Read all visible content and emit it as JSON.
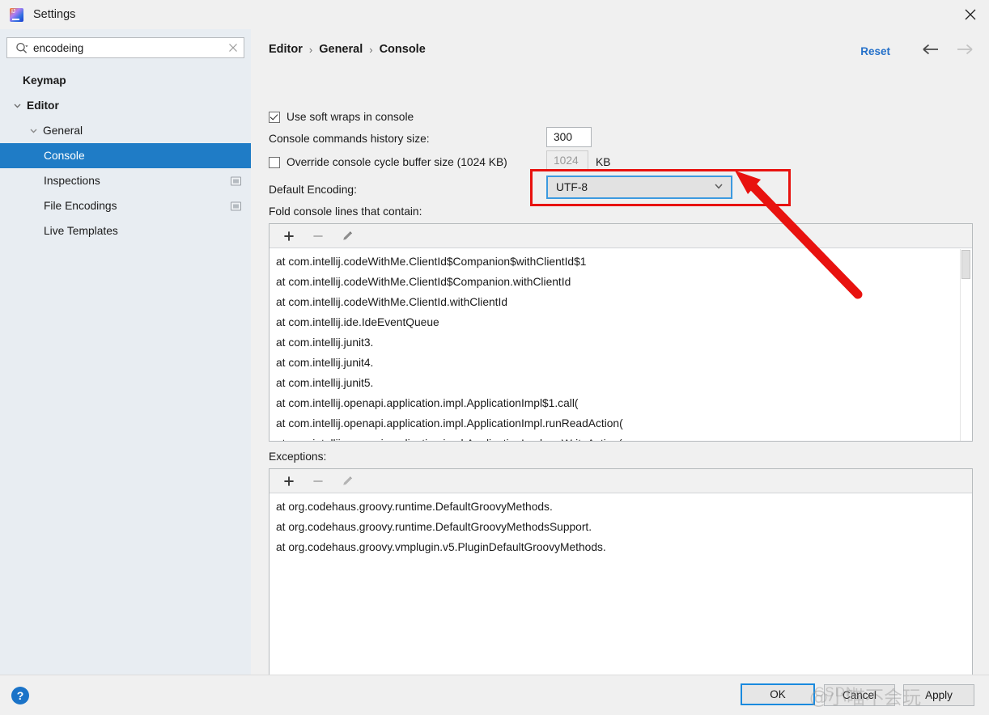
{
  "window": {
    "title": "Settings",
    "logo_icon": "intellij-idea-logo",
    "close_icon": "close-icon"
  },
  "search": {
    "value": "encodeing",
    "placeholder": "",
    "icon": "search-icon",
    "clear_icon": "clear-icon"
  },
  "sidebar": {
    "items": [
      {
        "label": "Keymap",
        "indent": 14,
        "bold": true,
        "arrow": "none",
        "selected": false,
        "badge": false
      },
      {
        "label": "Editor",
        "indent": 14,
        "bold": true,
        "arrow": "down",
        "selected": false,
        "badge": false
      },
      {
        "label": "General",
        "indent": 34,
        "bold": false,
        "arrow": "down",
        "selected": false,
        "badge": false
      },
      {
        "label": "Console",
        "indent": 54,
        "bold": false,
        "arrow": "none",
        "selected": true,
        "badge": false
      },
      {
        "label": "Inspections",
        "indent": 54,
        "bold": false,
        "arrow": "none",
        "selected": false,
        "badge": true
      },
      {
        "label": "File Encodings",
        "indent": 54,
        "bold": false,
        "arrow": "none",
        "selected": false,
        "badge": true
      },
      {
        "label": "Live Templates",
        "indent": 54,
        "bold": false,
        "arrow": "none",
        "selected": false,
        "badge": false
      }
    ]
  },
  "header": {
    "breadcrumb": [
      "Editor",
      "General",
      "Console"
    ],
    "separator": "›",
    "reset_label": "Reset",
    "back_icon": "arrow-left-icon",
    "forward_icon": "arrow-right-icon"
  },
  "settings": {
    "soft_wraps_label": "Use soft wraps in console",
    "soft_wraps_checked": true,
    "history_size_label": "Console commands history size:",
    "history_size_value": "300",
    "override_buffer_label": "Override console cycle buffer size (1024 KB)",
    "override_buffer_checked": false,
    "buffer_size_value": "1024",
    "buffer_units_label": "KB",
    "default_encoding_label": "Default Encoding:",
    "default_encoding_value": "UTF-8",
    "combo_chevron_icon": "chevron-down-icon",
    "fold_label": "Fold console lines that contain:",
    "exceptions_label": "Exceptions:"
  },
  "list_toolbar": {
    "add_icon": "plus-icon",
    "remove_icon": "minus-icon",
    "edit_icon": "pencil-icon"
  },
  "fold_list": {
    "items": [
      "at com.intellij.codeWithMe.ClientId$Companion$withClientId$1",
      "at com.intellij.codeWithMe.ClientId$Companion.withClientId",
      "at com.intellij.codeWithMe.ClientId.withClientId",
      "at com.intellij.ide.IdeEventQueue",
      "at com.intellij.junit3.",
      "at com.intellij.junit4.",
      "at com.intellij.junit5.",
      "at com.intellij.openapi.application.impl.ApplicationImpl$1.call(",
      "at com.intellij.openapi.application.impl.ApplicationImpl.runReadAction(",
      "at com.intellij.openapi.application.impl.ApplicationImpl.runWriteAction("
    ]
  },
  "exceptions_list": {
    "items": [
      "at org.codehaus.groovy.runtime.DefaultGroovyMethods.",
      "at org.codehaus.groovy.runtime.DefaultGroovyMethodsSupport.",
      "at org.codehaus.groovy.vmplugin.v5.PluginDefaultGroovyMethods."
    ]
  },
  "footer": {
    "help_icon": "help-icon",
    "help_glyph": "?",
    "ok_label": "OK",
    "cancel_label": "Cancel",
    "apply_label": "Apply"
  },
  "annotations": {
    "highlight_color": "#e8120f",
    "arrow_icon": "red-arrow-annotation"
  },
  "watermark": {
    "text": "@小喵不会玩",
    "brand": "CSDN"
  },
  "colors": {
    "accent": "#1f7cc6",
    "link": "#2470c9",
    "focus": "#3c9ae0",
    "sidebar_bg": "#e8edf2",
    "panel_bg": "#f0f0f0"
  }
}
